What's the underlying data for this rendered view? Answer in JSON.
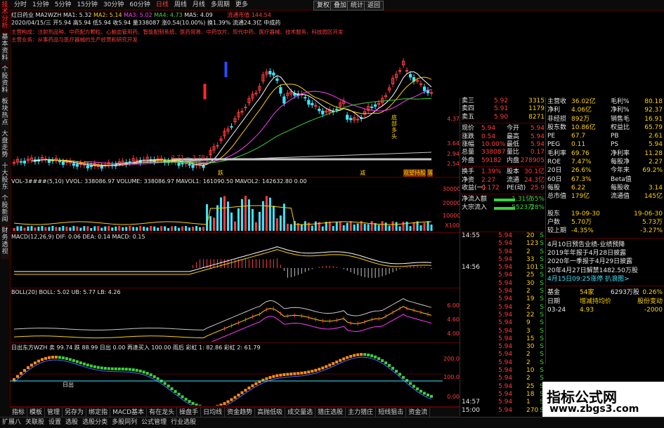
{
  "sidebar": {
    "tabs": [
      {
        "label": "技术分析",
        "active": true
      },
      {
        "label": "基本资料"
      },
      {
        "label": "个股资料"
      },
      {
        "label": "板块热点"
      },
      {
        "label": "大盘走势"
      },
      {
        "label": "十大股东"
      },
      {
        "label": "个股新闻"
      },
      {
        "label": "财务透视"
      }
    ]
  },
  "top_tabs": [
    "分时",
    "1分钟",
    "5分钟",
    "15分钟",
    "30分钟",
    "60分钟",
    "日线",
    "周线",
    "月线",
    "多周期",
    "更多"
  ],
  "active_top_tab": "日线",
  "top_buttons": {
    "quote": "复权",
    "overlay": "叠加",
    "stats": "统计",
    "back": "返回"
  },
  "main_info": {
    "stock": "红日药业",
    "indicator": "MA2WZH",
    "ma1": "MA1: 5.32",
    "ma2": "MA2: 5.14",
    "ma3": "MA3: 5.02",
    "ma4": "MA4: 4.73",
    "ma5": "MA5: 4.09",
    "date_line": "2020/04/15/三  开5.94 高5.94 低5.94 收5.94 量338087 涨0.54(10.00%) 换1.39% 流通24.3亿 中成药",
    "notice_red": "流通市值 144.54",
    "notice1": "主营构成：注射剂品种、中药配方颗粒、心脑血管用药、智能配制系统、医药贸易、中药饮片、现代中药、医疗器械、技术服务、科技园区开发",
    "notice2": "主营业务：从事药品与医疗器械的生产经营和研究开发",
    "annot_low": "2.71 ~ 3.78",
    "annot_1": "跌",
    "annot_2": "减",
    "annot_3": "底部多头",
    "annot_4": "观望",
    "annot_5": "持股",
    "annot_6": "落"
  },
  "main_axis": [
    "4.37",
    "3.64",
    "2.94",
    "2.54"
  ],
  "vol": {
    "header": "VOL-3####(5,10) VVOL: 338086.97  VOLUME: 338086.97  MAVOL1: 161090.50  MAVOL2: 142632.80  0.00",
    "axis": [
      "30000",
      "20000",
      "10000",
      "X100"
    ]
  },
  "macd": {
    "header": "MACD(12,26,9) DIF: 0.06 DEA: 0.14 MACD: 0.15"
  },
  "boll": {
    "header": "BOLL(20) BOLL: 5.02 UB: 5.77 LB: 4.26",
    "axis": [
      "6.00",
      "4.60",
      "4.00"
    ]
  },
  "sun": {
    "header": "日出东方WZH 卖 99.74  跌 88.99 日出 0.00  再逢买入 100.00  雨后  彩虹 1: 82.86  彩虹 2: 61.79",
    "axis": [
      "200.0",
      "100.0",
      "0.00"
    ],
    "label_left": "日出"
  },
  "bottom_tabs": [
    "指标",
    "模板",
    "管理",
    "另存为",
    "绑定指",
    "MACD基本",
    "有在龙头",
    "操盘手",
    "日均线",
    "资金趋势",
    "高抛低吸",
    "成交量选",
    "猎庄选股",
    "主力猎庄",
    "短线狙击",
    "资金流",
    "主力动向",
    "散户"
  ],
  "status_bar": [
    "扩展八",
    "关联股",
    "设置",
    "选股",
    "选股分类",
    "多股同列",
    "公式管理",
    "行业选股"
  ],
  "orderbook": [
    {
      "label": "卖三",
      "price": "5.92",
      "vol": "3315"
    },
    {
      "label": "卖四",
      "price": "5.91",
      "vol": "1179"
    },
    {
      "label": "卖五",
      "price": "5.90",
      "vol": "8271"
    }
  ],
  "quote": [
    {
      "l": "现价",
      "v": "5.94",
      "l2": "今开",
      "v2": "5.94"
    },
    {
      "l": "涨跌",
      "v": "0.54",
      "l2": "最高",
      "v2": "5.94"
    },
    {
      "l": "涨幅",
      "v": "10.00%",
      "l2": "最低",
      "v2": "5.94"
    },
    {
      "l": "总量",
      "v": "338087",
      "l2": "量比",
      "v2": "0.17"
    },
    {
      "l": "外盘",
      "v": "59182",
      "l2": "内盘",
      "v2": "278905"
    }
  ],
  "quote2": [
    {
      "l": "换手",
      "v": "1.39%",
      "l2": "股本",
      "v2": "30.1亿"
    },
    {
      "l": "净资",
      "v": "2.27",
      "l2": "流通",
      "v2": "24.3亿"
    },
    {
      "l": "收益(一)",
      "v": "0.172",
      "l2": "PE(动)",
      "v2": "25.9"
    }
  ],
  "flow": [
    {
      "l": "净流入额",
      "v": "-1.31亿",
      "p": "-65%"
    },
    {
      "l": "大宗流入",
      "v": "-5523万",
      "p": "-28%"
    }
  ],
  "ticks": [
    {
      "t": "14:55",
      "p": "5.94",
      "v": "20",
      "s": "S"
    },
    {
      "t": "",
      "p": "5.94",
      "v": "123",
      "s": "S"
    },
    {
      "t": "",
      "p": "5.94",
      "v": "2",
      "s": "S"
    },
    {
      "t": "",
      "p": "5.94",
      "v": "33",
      "s": "S"
    },
    {
      "t": "14:56",
      "p": "5.94",
      "v": "101",
      "s": "S"
    },
    {
      "t": "",
      "p": "5.94",
      "v": "25",
      "s": "S"
    },
    {
      "t": "",
      "p": "5.94",
      "v": "30",
      "s": "S"
    },
    {
      "t": "",
      "p": "5.94",
      "v": "2",
      "s": "S"
    },
    {
      "t": "",
      "p": "5.94",
      "v": "19",
      "s": "S"
    },
    {
      "t": "",
      "p": "5.94",
      "v": "2",
      "s": "S"
    },
    {
      "t": "",
      "p": "5.94",
      "v": "22",
      "s": "S"
    },
    {
      "t": "",
      "p": "5.94",
      "v": "9",
      "s": "S"
    },
    {
      "t": "",
      "p": "5.94",
      "v": "3",
      "s": "S"
    },
    {
      "t": "",
      "p": "5.94",
      "v": "15",
      "s": "S"
    },
    {
      "t": "",
      "p": "5.94",
      "v": "30",
      "s": "S"
    },
    {
      "t": "",
      "p": "5.94",
      "v": "2",
      "s": "S"
    },
    {
      "t": "",
      "p": "5.94",
      "v": "2",
      "s": "S"
    },
    {
      "t": "",
      "p": "5.94",
      "v": "10",
      "s": "S"
    },
    {
      "t": "",
      "p": "5.94",
      "v": "2",
      "s": "S"
    },
    {
      "t": "",
      "p": "5.94",
      "v": "25",
      "s": "S"
    },
    {
      "t": "",
      "p": "5.94",
      "v": "18",
      "s": "S"
    },
    {
      "t": "14:57",
      "p": "5.94",
      "v": "1",
      "s": "S"
    },
    {
      "t": "15:00",
      "p": "5.94",
      "v": "270",
      "s": "S"
    }
  ],
  "fund_top": [
    {
      "l": "主营收",
      "v": "36.02亿",
      "l2": "毛利%",
      "v2": "80.18"
    },
    {
      "l": "净利",
      "v": "4.06亿",
      "l2": "净利%",
      "v2": "92.37"
    },
    {
      "l": "非经损",
      "v": "892万",
      "l2": "销售毛",
      "v2": "16.91"
    },
    {
      "l": "股东数",
      "v": "10.86亿",
      "l2": "权益比",
      "v2": "65.79"
    },
    {
      "l": "PE",
      "v": "67.7",
      "l2": "PB",
      "v2": "2.61"
    },
    {
      "l": "PEG",
      "v": "0.11",
      "l2": "PS",
      "v2": "5.94"
    },
    {
      "l": "毛利率",
      "v": "69.76",
      "l2": "净利率",
      "v2": "11.28"
    },
    {
      "l": "ROE",
      "v": "7.47%",
      "l2": "每股净",
      "v2": "2.27"
    },
    {
      "l": "20日",
      "v": "26.6%",
      "l2": "今年来",
      "v2": "69.2%"
    },
    {
      "l": "60日",
      "v": "67.3%",
      "l2": "Beta值",
      "v2": ""
    },
    {
      "l": "每股",
      "v": "6.22",
      "l2": "每股收",
      "v2": "3.14"
    },
    {
      "l": "总市值",
      "v": "179亿",
      "l2": "流通值",
      "v2": "145亿"
    },
    {
      "l": "",
      "v": "",
      "l2": "",
      "v2": ""
    },
    {
      "l": "股东",
      "v": "19-09-30",
      "l2": "",
      "v2": "19-06-30"
    },
    {
      "l": "户数",
      "v": "5.70万",
      "l2": "",
      "v2": "5.73万"
    },
    {
      "l": "较上期",
      "v": "-4.35%",
      "l2": "",
      "v2": "-3.27%"
    }
  ],
  "fund_notices": [
    "4月10日预告业绩-业绩预降",
    "2019年年报于4月28日披露",
    "2020年一季报于4月29日披露",
    "20年4月27日解禁1482.50万股",
    "4月15日09:25涨停 扒浪图>"
  ],
  "fund_bottom": [
    {
      "l": "基金",
      "v": "54家",
      "l2": "6293万股",
      "v2": "0.26%"
    },
    {
      "l": "日期",
      "v": "增减持均价",
      "l2": "",
      "v2": "股份变动"
    },
    {
      "l": "03-24",
      "v": "4.93",
      "l2": "",
      "v2": "-2000"
    }
  ],
  "watermark": {
    "title": "指标公式网",
    "url": "www.zbgs3.com"
  }
}
